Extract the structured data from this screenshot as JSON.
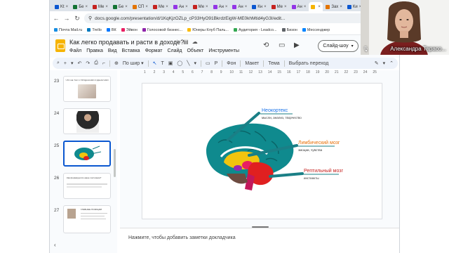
{
  "browser": {
    "tabs": [
      {
        "label": "Kt",
        "color": "#0b57d0"
      },
      {
        "label": "Бе",
        "color": "#137333"
      },
      {
        "label": "Ме",
        "color": "#c5221f"
      },
      {
        "label": "Бе",
        "color": "#137333"
      },
      {
        "label": "СП",
        "color": "#e37400"
      },
      {
        "label": "Ме",
        "color": "#c5221f"
      },
      {
        "label": "Ан",
        "color": "#9334e6"
      },
      {
        "label": "Ме",
        "color": "#c5221f"
      },
      {
        "label": "Ан",
        "color": "#9334e6"
      },
      {
        "label": "Ан",
        "color": "#9334e6"
      },
      {
        "label": "Кн",
        "color": "#0b57d0"
      },
      {
        "label": "Ме",
        "color": "#c5221f"
      },
      {
        "label": "Ан",
        "color": "#9334e6"
      },
      {
        "label": "",
        "color": "#f6b400"
      },
      {
        "label": "Зах",
        "color": "#e37400"
      },
      {
        "label": "Ки",
        "color": "#0b57d0"
      },
      {
        "label": "Ге",
        "color": "#137333"
      }
    ],
    "url": "docs.google.com/presentation/d/1KqKjzOZLp_cP33HyO91BkrdzEigW-ME0khMtid4yG3I/edit...",
    "bookmarks": [
      {
        "label": "Почта Mail.ru",
        "color": "#168de2"
      },
      {
        "label": "Trello",
        "color": "#0079bf"
      },
      {
        "label": "ВК",
        "color": "#0077ff"
      },
      {
        "label": "Эйвон",
        "color": "#e91e63"
      },
      {
        "label": "Голосовой бизнес...",
        "color": "#8e24aa"
      },
      {
        "label": "Юнеры Клуб Паль...",
        "color": "#fbbc04"
      },
      {
        "label": "Аудитория - Leadco...",
        "color": "#34a853"
      },
      {
        "label": "Бизон",
        "color": "#5f6368"
      },
      {
        "label": "Мессенджер",
        "color": "#0084ff"
      }
    ],
    "partial_button": "Закреп"
  },
  "doc": {
    "title": "Как легко продавать и расти в доходе?",
    "menu": [
      "Файл",
      "Правка",
      "Вид",
      "Вставка",
      "Формат",
      "Слайд",
      "Объект",
      "Инструменты"
    ],
    "slideshow_label": "Слайд-шоу"
  },
  "toolbar": {
    "fit_label": "По шир",
    "background": "Фон",
    "layout": "Макет",
    "theme": "Тема",
    "transition": "Выбрать переход"
  },
  "ruler_ticks": [
    "1",
    "2",
    "3",
    "4",
    "5",
    "6",
    "7",
    "8",
    "9",
    "10",
    "11",
    "12",
    "13",
    "14",
    "15",
    "16",
    "17",
    "18",
    "19",
    "20",
    "21",
    "22",
    "23",
    "24",
    "25"
  ],
  "filmstrip": {
    "slides": [
      {
        "number": "23"
      },
      {
        "number": "24"
      },
      {
        "number": "25",
        "selected": true
      },
      {
        "number": "26"
      },
      {
        "number": "27"
      }
    ],
    "slide23_text": "ЧТО НЕ ТАК С ПРОДАЖАМИ И ДЕНЬГАМИ",
    "slide26_text": "Как формируется наше состояние?",
    "slide27_text": "ГЛАВНЫЕ ПОЗИЦИИ"
  },
  "slide": {
    "labels": {
      "neocortex_title": "Неокортекс",
      "neocortex_sub": "мысли, анализ, творчество",
      "limbic_title": "Лимбический мозг",
      "limbic_sub": "эмоции, чувства",
      "reptile_title": "Рептильный мозг",
      "reptile_sub": "инстинкты"
    },
    "colors": {
      "neocortex": "#0f8a8e",
      "limbic": "#f1c40f",
      "reptile": "#e02020",
      "arrow": "#1a7f86"
    }
  },
  "notes": {
    "placeholder": "Нажмите, чтобы добавить заметки докладчика"
  },
  "webcam": {
    "name": "Александра Тарасо..."
  }
}
